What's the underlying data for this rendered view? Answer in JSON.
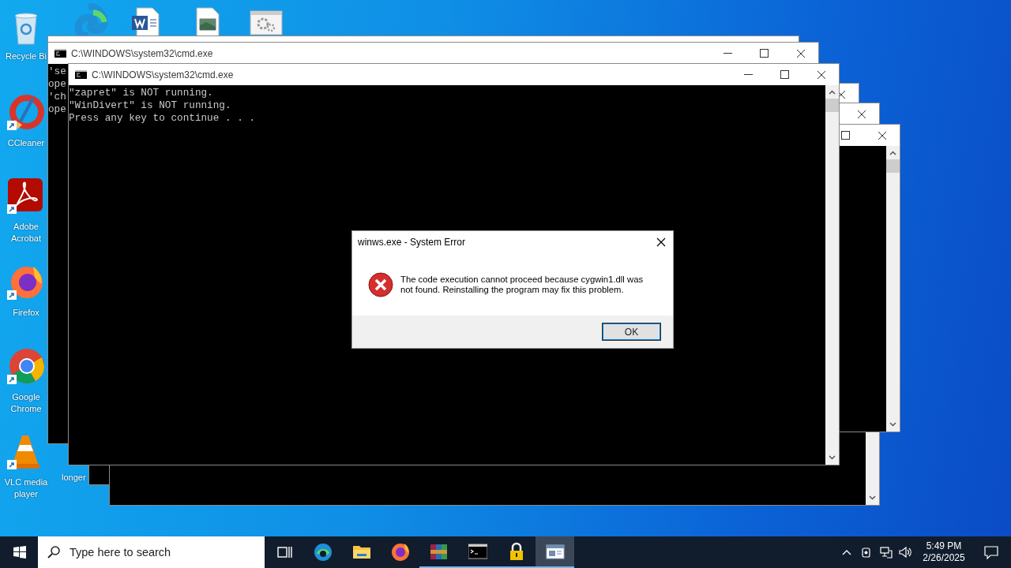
{
  "desktop_icons": [
    {
      "kind": "recycle",
      "label": "Recycle Bi"
    },
    {
      "kind": "ccleaner",
      "label": "CCleaner"
    },
    {
      "kind": "acrobat",
      "label": "Adobe Acrobat"
    },
    {
      "kind": "firefox",
      "label": "Firefox"
    },
    {
      "kind": "chrome",
      "label": "Google Chrome"
    },
    {
      "kind": "vlc",
      "label": "VLC media player"
    },
    {
      "kind": "file",
      "label": "longer"
    }
  ],
  "console_windows": [
    {
      "title": "C:\\WINDOWS\\system32\\cmd.exe",
      "lines": [
        "'se",
        "ope",
        "'ch",
        "ope"
      ]
    },
    {
      "title": "C:\\WINDOWS\\system32\\cmd.exe",
      "lines": [
        "\"zapret\" is NOT running.",
        "\"WinDivert\" is NOT running.",
        "Press any key to continue . . ."
      ]
    }
  ],
  "dialog": {
    "title": "winws.exe - System Error",
    "message": "The code execution cannot proceed because cygwin1.dll was not found. Reinstalling the program may fix this problem.",
    "buttons": [
      "OK"
    ]
  },
  "taskbar": {
    "search": {
      "placeholder": "Type here to search"
    },
    "apps": [
      {
        "kind": "taskview",
        "running": false,
        "selected": false
      },
      {
        "kind": "edge",
        "running": false,
        "selected": false
      },
      {
        "kind": "explorer",
        "running": false,
        "selected": false
      },
      {
        "kind": "firefox",
        "running": false,
        "selected": false
      },
      {
        "kind": "winrar",
        "running": true,
        "selected": false
      },
      {
        "kind": "cmd",
        "running": true,
        "selected": false
      },
      {
        "kind": "lock",
        "running": true,
        "selected": false
      },
      {
        "kind": "window",
        "running": true,
        "selected": true
      }
    ],
    "time": "5:49 PM",
    "date": "2/26/2025"
  }
}
